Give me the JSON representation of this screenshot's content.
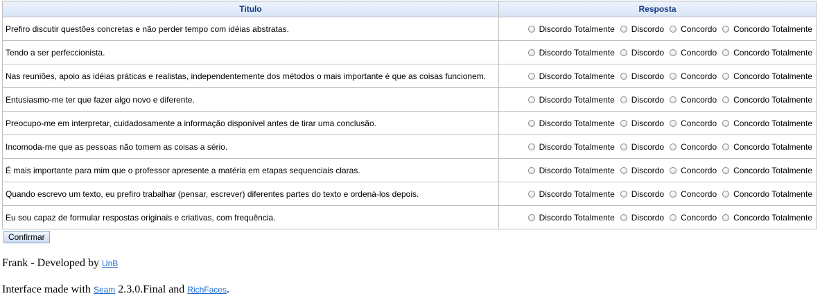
{
  "table": {
    "headers": [
      "Titulo",
      "Resposta"
    ],
    "options": [
      "Discordo Totalmente",
      "Discordo",
      "Concordo",
      "Concordo Totalmente"
    ],
    "rows": [
      "Prefiro discutir questões concretas e não perder tempo com idéias abstratas.",
      "Tendo a ser perfeccionista.",
      "Nas reuniões, apoio as idéias práticas e realistas, independentemente dos métodos o mais importante é que as coisas funcionem.",
      "Entusiasmo-me ter que fazer algo novo e diferente.",
      "Preocupo-me em interpretar, cuidadosamente a informação disponível antes de tirar uma conclusão.",
      "Incomoda-me que as pessoas não tomem as coisas a sério.",
      "É mais importante para mim que o professor apresente a matéria em etapas sequenciais claras.",
      "Quando escrevo um texto, eu prefiro trabalhar (pensar, escrever) diferentes partes do texto e ordená-los depois.",
      "Eu sou capaz de formular respostas originais e criativas, com frequência."
    ]
  },
  "confirm_label": "Confirmar",
  "footer": {
    "line1_text": "Frank - Developed by ",
    "line1_link": "UnB",
    "line2_text1": "Interface made with ",
    "line2_link1": "Seam",
    "line2_text2": " 2.3.0.Final and ",
    "line2_link2": "RichFaces",
    "line2_text3": "."
  }
}
